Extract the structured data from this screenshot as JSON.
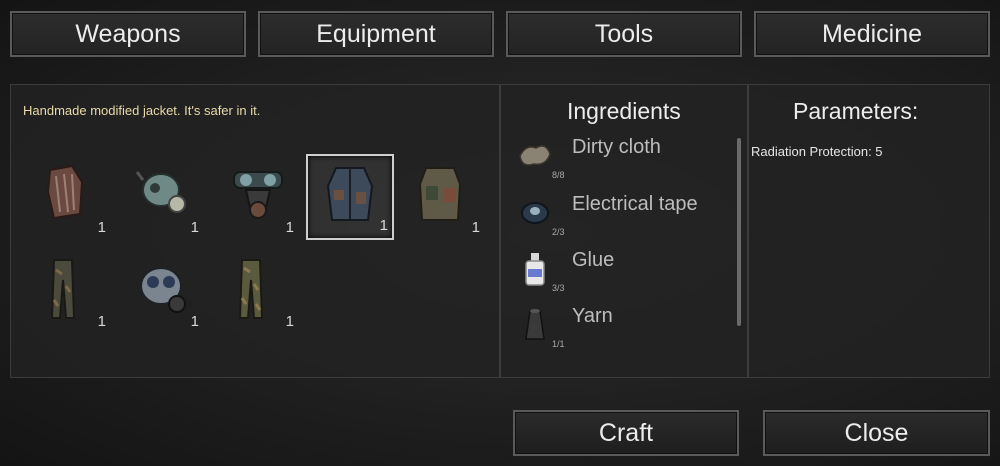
{
  "tabs": {
    "weapons": "Weapons",
    "equipment": "Equipment",
    "tools": "Tools",
    "medicine": "Medicine"
  },
  "description": "Handmade modified jacket. It's safer in it.",
  "items": [
    {
      "icon": "gloves-icon",
      "count": "1"
    },
    {
      "icon": "respirator-icon",
      "count": "1"
    },
    {
      "icon": "gas-mask-goggles-icon",
      "count": "1"
    },
    {
      "icon": "modified-jacket-icon",
      "count": "1",
      "selected": true
    },
    {
      "icon": "vest-icon",
      "count": "1"
    },
    {
      "icon": "camo-pants-icon",
      "count": "1"
    },
    {
      "icon": "gas-mask-icon",
      "count": "1"
    },
    {
      "icon": "camo-trousers-icon",
      "count": "1"
    }
  ],
  "ingredients": {
    "heading": "Ingredients",
    "list": [
      {
        "name": "Dirty cloth",
        "qty": "8/8",
        "icon": "cloth-icon"
      },
      {
        "name": "Electrical tape",
        "qty": "2/3",
        "icon": "tape-icon"
      },
      {
        "name": "Glue",
        "qty": "3/3",
        "icon": "glue-bottle-icon"
      },
      {
        "name": "Yarn",
        "qty": "1/1",
        "icon": "yarn-icon"
      }
    ]
  },
  "parameters": {
    "heading": "Parameters:",
    "text": "Radiation Protection: 5"
  },
  "buttons": {
    "craft": "Craft",
    "close": "Close"
  }
}
